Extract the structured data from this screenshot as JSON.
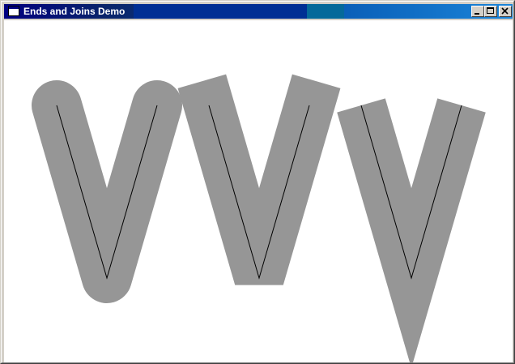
{
  "window": {
    "title": "Ends and Joins Demo",
    "titlebar_colors": {
      "start": "#000080",
      "end": "#1084d0"
    }
  },
  "caption_buttons": {
    "minimize": "minimize-icon",
    "maximize": "maximize-icon",
    "close": "close-icon"
  },
  "canvas": {
    "background": "#ffffff",
    "wide_stroke_color": "#969696",
    "thin_stroke_color": "#000000",
    "figures": [
      {
        "name": "round-end-round-join",
        "cap": "round",
        "join": "round"
      },
      {
        "name": "square-end-bevel-join",
        "cap": "square",
        "join": "bevel"
      },
      {
        "name": "flat-end-miter-join",
        "cap": "butt",
        "join": "miter"
      }
    ]
  }
}
